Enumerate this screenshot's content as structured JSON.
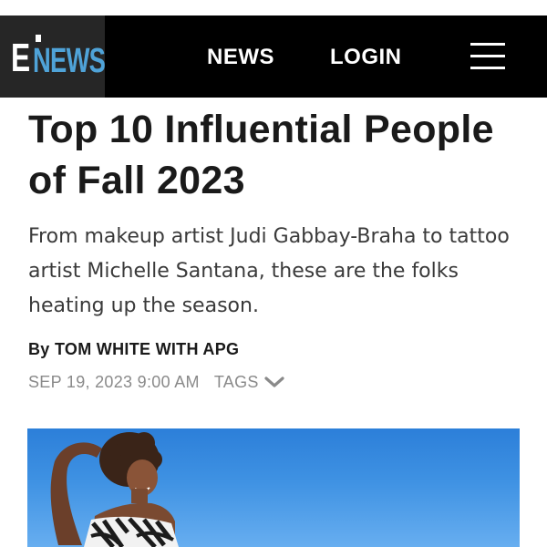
{
  "header": {
    "logo_mark": "E",
    "logo_word": "NEWS",
    "nav": {
      "news_label": "NEWS",
      "login_label": "LOGIN"
    },
    "menu_icon": "hamburger-menu-icon"
  },
  "article": {
    "title": "Top 10 Influential People of Fall 2023",
    "dek": "From makeup artist Judi Gabbay-Braha to tattoo artist Michelle Santana, these are the folks heating up the season.",
    "byline": {
      "prefix": "By",
      "author": "TOM WHITE WITH APG"
    },
    "date": "SEP 19, 2023 9:00 AM",
    "tags_label": "TAGS",
    "tags_icon": "chevron-down-icon"
  },
  "colors": {
    "nav_background": "#000000",
    "logo_background": "#262626",
    "logo_accent": "#4fa3d8",
    "headline": "#1a1a1a",
    "meta": "#8a8a8a",
    "hero_sky": "#3f92e3"
  }
}
